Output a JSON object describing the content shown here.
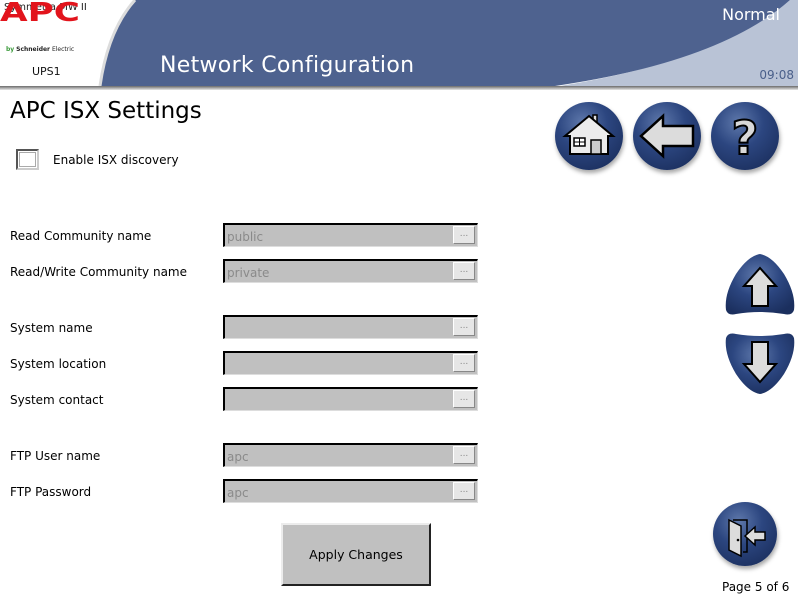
{
  "header": {
    "model": "Symmetra MW II",
    "brand": "APC",
    "brand_byline_prefix": "by",
    "brand_byline_company": "Schneider",
    "brand_byline_suffix": "Electric",
    "device_name": "UPS1",
    "section_title": "Network Configuration",
    "status": "Normal",
    "time": "09:08"
  },
  "page": {
    "title": "APC ISX Settings",
    "page_indicator": "Page 5 of 6"
  },
  "toolbar": {
    "home_icon": "home-icon",
    "back_icon": "back-arrow-icon",
    "help_icon": "help-icon"
  },
  "settings": {
    "enable_isx": {
      "label": "Enable ISX discovery",
      "checked": false
    },
    "fields": [
      {
        "label": "Read Community name",
        "value": "public"
      },
      {
        "label": "Read/Write Community name",
        "value": "private"
      },
      {
        "label": "System name",
        "value": ""
      },
      {
        "label": "System location",
        "value": ""
      },
      {
        "label": "System contact",
        "value": ""
      },
      {
        "label": "FTP User name",
        "value": "apc"
      },
      {
        "label": "FTP Password",
        "value": "apc"
      }
    ],
    "ellipsis": "..."
  },
  "actions": {
    "apply_label": "Apply Changes"
  },
  "colors": {
    "header_blue": "#4e628f",
    "header_corner": "#b9c3d6",
    "button_blue": "#2c4680",
    "apc_red": "#e2141c"
  }
}
